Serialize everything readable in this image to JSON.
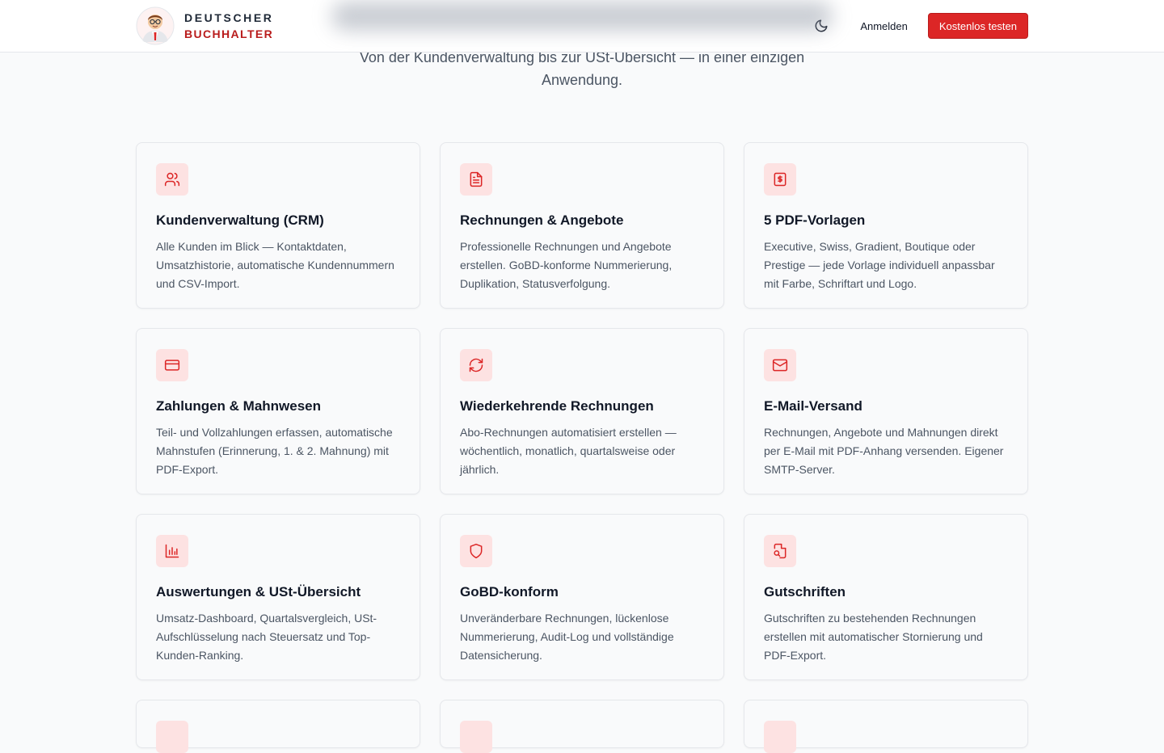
{
  "header": {
    "brand_line1": "DEUTSCHER",
    "brand_line2": "BUCHHALTER",
    "theme_toggle_icon": "moon-icon",
    "login_label": "Anmelden",
    "cta_label": "Kostenlos testen"
  },
  "intro": {
    "subtitle": "Von der Kundenverwaltung bis zur USt-Übersicht — in einer einzigen Anwendung."
  },
  "features": [
    {
      "icon": "users-icon",
      "title": "Kundenverwaltung (CRM)",
      "desc": "Alle Kunden im Blick — Kontaktdaten, Umsatzhistorie, automatische Kundennummern und CSV-Import."
    },
    {
      "icon": "file-text-icon",
      "title": "Rechnungen & Angebote",
      "desc": "Professionelle Rechnungen und Angebote erstellen. GoBD-konforme Nummerierung, Duplikation, Statusverfolgung."
    },
    {
      "icon": "receipt-dollar-icon",
      "title": "5 PDF-Vorlagen",
      "desc": "Executive, Swiss, Gradient, Boutique oder Prestige — jede Vorlage individuell anpassbar mit Farbe, Schriftart und Logo."
    },
    {
      "icon": "credit-card-icon",
      "title": "Zahlungen & Mahnwesen",
      "desc": "Teil- und Vollzahlungen erfassen, automatische Mahnstufen (Erinnerung, 1. & 2. Mahnung) mit PDF-Export."
    },
    {
      "icon": "refresh-icon",
      "title": "Wiederkehrende Rechnungen",
      "desc": "Abo-Rechnungen automatisiert erstellen — wöchentlich, monatlich, quartalsweise oder jährlich."
    },
    {
      "icon": "mail-icon",
      "title": "E-Mail-Versand",
      "desc": "Rechnungen, Angebote und Mahnungen direkt per E-Mail mit PDF-Anhang versenden. Eigener SMTP-Server."
    },
    {
      "icon": "bar-chart-icon",
      "title": "Auswertungen & USt-Übersicht",
      "desc": "Umsatz-Dashboard, Quartalsvergleich, USt-Aufschlüsselung nach Steuersatz und Top-Kunden-Ranking."
    },
    {
      "icon": "shield-icon",
      "title": "GoBD-konform",
      "desc": "Unveränderbare Rechnungen, lückenlose Nummerierung, Audit-Log und vollständige Datensicherung."
    },
    {
      "icon": "file-search-icon",
      "title": "Gutschriften",
      "desc": "Gutschriften zu bestehenden Rechnungen erstellen mit automatischer Stornierung und PDF-Export."
    }
  ],
  "colors": {
    "accent": "#dc2626",
    "icon_bg": "#fde2e2",
    "brand_red": "#b91c1c"
  }
}
